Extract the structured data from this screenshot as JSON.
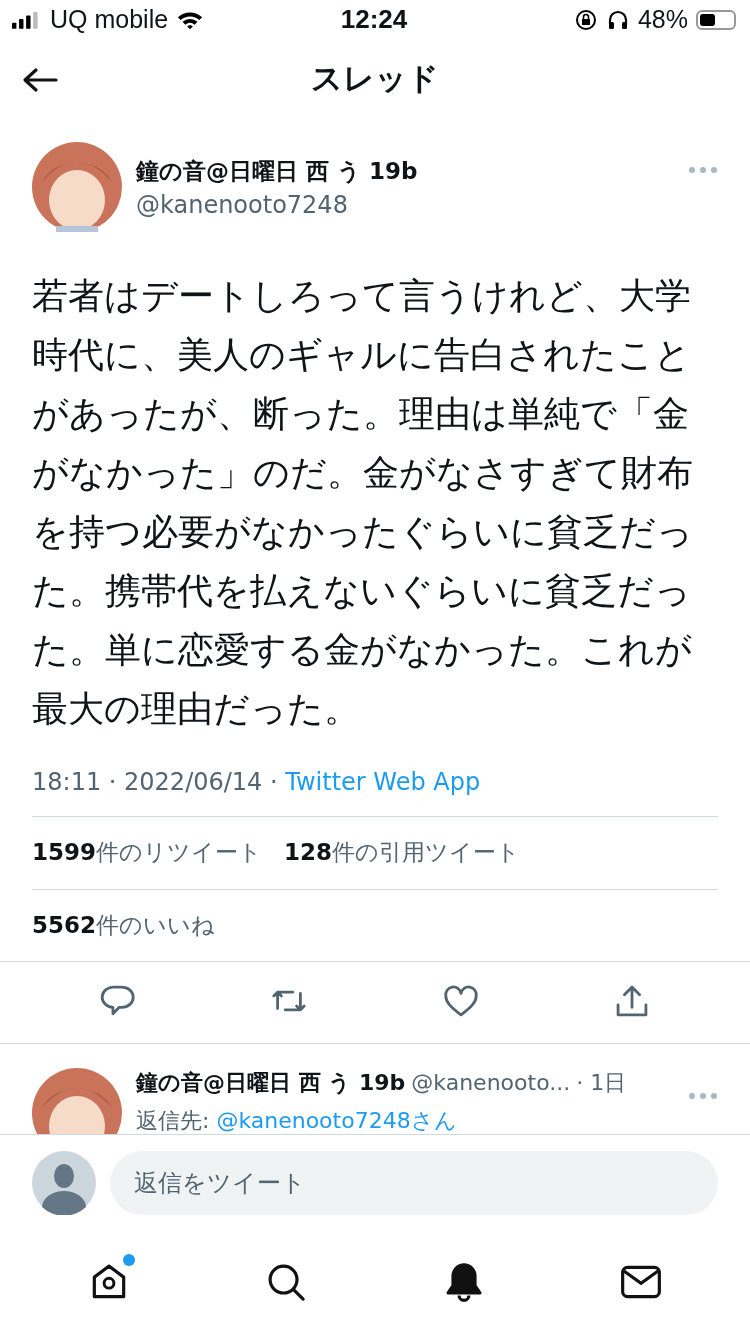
{
  "status_bar": {
    "carrier": "UQ mobile",
    "time": "12:24",
    "battery": "48%"
  },
  "header": {
    "title": "スレッド"
  },
  "tweet": {
    "name": "鐘の音@日曜日 西 う 19b",
    "handle": "@kanenooto7248",
    "text": "若者はデートしろって言うけれど、大学時代に、美人のギャルに告白されたことがあったが、断った。理由は単純で「金がなかった」のだ。金がなさすぎて財布を持つ必要がなかったぐらいに貧乏だった。携帯代を払えないぐらいに貧乏だった。単に恋愛する金がなかった。これが最大の理由だった。",
    "time": "18:11 · 2022/06/14 · ",
    "source": "Twitter Web App",
    "stats": [
      {
        "count": "1599",
        "label": "件のリツイート"
      },
      {
        "count": "128",
        "label": "件の引用ツイート"
      }
    ],
    "likes": {
      "count": "5562",
      "label": "件のいいね"
    },
    "actions": [
      {
        "kind": "reply"
      },
      {
        "kind": "retweet"
      },
      {
        "kind": "like"
      },
      {
        "kind": "share"
      }
    ]
  },
  "reply": {
    "name": "鐘の音@日曜日 西 う 19b",
    "handle": "@kanenooto...",
    "time": "· 1日",
    "reply_to_label": "返信先: ",
    "reply_to": "@kanenooto7248さん"
  },
  "composer": {
    "placeholder": "返信をツイート"
  },
  "tab_bar": [
    {
      "kind": "home",
      "selected": false,
      "badge": true
    },
    {
      "kind": "search",
      "selected": false,
      "badge": false
    },
    {
      "kind": "notifications",
      "selected": true,
      "badge": false
    },
    {
      "kind": "messages",
      "selected": false,
      "badge": false
    }
  ]
}
